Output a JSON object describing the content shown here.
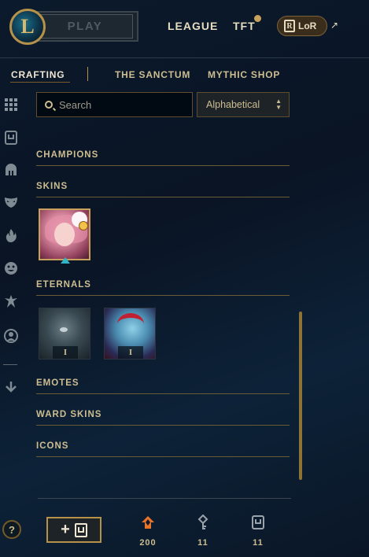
{
  "topbar": {
    "play_label": "PLAY",
    "nav": {
      "league": "LEAGUE",
      "tft": "TFT",
      "lor": "LoR"
    }
  },
  "subnav": {
    "tabs": [
      {
        "label": "CRAFTING",
        "active": true
      },
      {
        "label": "THE SANCTUM",
        "active": false
      },
      {
        "label": "MYTHIC SHOP",
        "active": false
      }
    ]
  },
  "sidebar": {
    "icons": [
      "grid-icon",
      "chest-icon",
      "helmet-icon",
      "mask-icon",
      "flame-icon",
      "emote-icon",
      "ward-icon",
      "profile-icon",
      "sort-icon",
      "help-icon"
    ],
    "help_label": "?"
  },
  "filters": {
    "search_placeholder": "Search",
    "sort_value": "Alphabetical"
  },
  "sections": {
    "champions": "CHAMPIONS",
    "skins": "SKINS",
    "eternals": "ETERNALS",
    "emotes": "EMOTES",
    "ward_skins": "WARD SKINS",
    "icons": "ICONS"
  },
  "eternals": [
    {
      "rank": "I"
    },
    {
      "rank": "I"
    }
  ],
  "footer": {
    "add_label": "+",
    "currencies": [
      {
        "icon": "orange-essence-icon",
        "value": "200"
      },
      {
        "icon": "key-icon",
        "value": "11"
      },
      {
        "icon": "chest-icon",
        "value": "11"
      }
    ]
  },
  "colors": {
    "gold": "#cdbe91",
    "accent": "#c8a25c",
    "essence": "#e8742a",
    "caret": "#2fb6c8"
  }
}
